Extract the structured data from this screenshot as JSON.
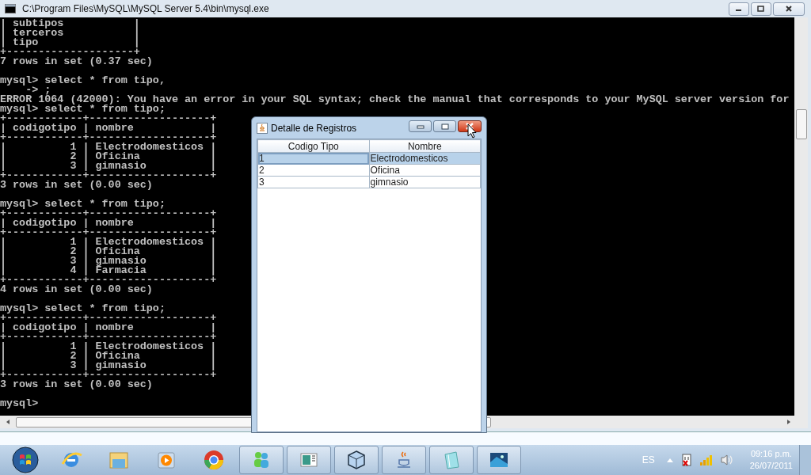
{
  "console": {
    "title": "C:\\Program Files\\MySQL\\MySQL Server 5.4\\bin\\mysql.exe",
    "blocks": [
      [
        "| subtipos           |",
        "| terceros           |",
        "| tipo               |",
        "+--------------------+",
        "7 rows in set (0.37 sec)"
      ],
      [
        "mysql> select * from tipo,",
        "    -> ;",
        "ERROR 1064 (42000): You have an error in your SQL syntax; check the manual that corresponds to your MySQL server version for",
        "mysql> select * from tipo;",
        "+------------+-------------------+",
        "| codigotipo | nombre            |",
        "+------------+-------------------+",
        "|          1 | Electrodomesticos |",
        "|          2 | Oficina           |",
        "|          3 | gimnasio          |",
        "+------------+-------------------+",
        "3 rows in set (0.00 sec)"
      ],
      [
        "mysql> select * from tipo;",
        "+------------+-------------------+",
        "| codigotipo | nombre            |",
        "+------------+-------------------+",
        "|          1 | Electrodomesticos |",
        "|          2 | Oficina           |",
        "|          3 | gimnasio          |",
        "|          4 | Farmacia          |",
        "+------------+-------------------+",
        "4 rows in set (0.00 sec)"
      ],
      [
        "mysql> select * from tipo;",
        "+------------+-------------------+",
        "| codigotipo | nombre            |",
        "+------------+-------------------+",
        "|          1 | Electrodomesticos |",
        "|          2 | Oficina           |",
        "|          3 | gimnasio          |",
        "+------------+-------------------+",
        "3 rows in set (0.00 sec)"
      ],
      [
        "mysql>"
      ]
    ]
  },
  "dialog": {
    "title": "Detalle de Registros",
    "columns": [
      "Codigo Tipo",
      "Nombre"
    ],
    "rows": [
      {
        "cells": [
          "1",
          "Electrodomesticos"
        ],
        "selected": true
      },
      {
        "cells": [
          "2",
          "Oficina"
        ],
        "selected": false
      },
      {
        "cells": [
          "3",
          "gimnasio"
        ],
        "selected": false
      }
    ]
  },
  "taskbar": {
    "items": [
      {
        "kind": "orb",
        "running": false
      },
      {
        "kind": "globe",
        "running": false
      },
      {
        "kind": "folder",
        "running": false
      },
      {
        "kind": "play",
        "running": false
      },
      {
        "kind": "wheel",
        "running": false
      },
      {
        "kind": "people",
        "running": true
      },
      {
        "kind": "document",
        "running": true
      },
      {
        "kind": "cube",
        "running": true
      },
      {
        "kind": "cup",
        "running": true
      },
      {
        "kind": "notepad",
        "running": true
      },
      {
        "kind": "picture",
        "running": true
      }
    ],
    "language": "ES",
    "time": "09:16 p.m.",
    "date": "26/07/2011"
  }
}
